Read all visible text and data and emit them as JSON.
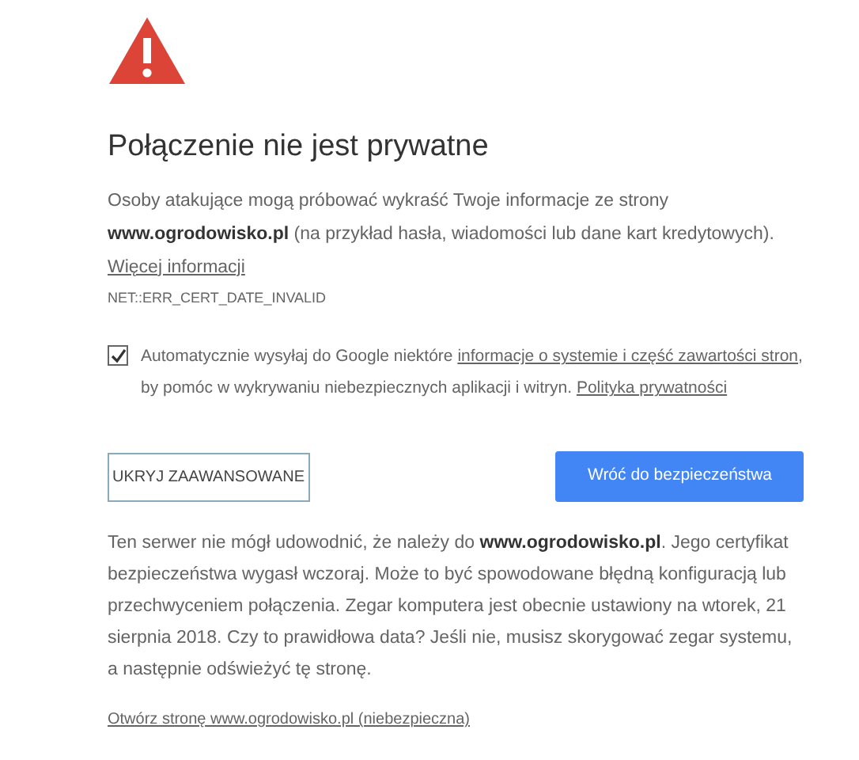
{
  "title": "Połączenie nie jest prywatne",
  "intro": {
    "text": "Osoby atakujące mogą próbować wykraść Twoje informacje ze strony **www.ogrodowisko.pl** (na przykład hasła, wiadomości lub dane kart kredytowych).",
    "link": "Więcej informacji"
  },
  "error_code": "NET::ERR_CERT_DATE_INVALID",
  "report": {
    "checked": true,
    "text_before": "Automatycznie wysyłaj do Google niektóre",
    "link": "informacje o systemie i część zawartości stron",
    "text_after": ", by pomóc w wykrywaniu niebezpiecznych aplikacji i witryn.",
    "privacy_link": "Polityka prywatności"
  },
  "buttons": [
    {
      "kind": "secondary",
      "label": "UKRYJ ZAAWANSOWANE"
    },
    {
      "kind": "primary",
      "label": "Wróć do bezpieczeństwa"
    }
  ],
  "details": "Ten serwer nie mógł udowodnić, że należy do **www.ogrodowisko.pl**. Jego certyfikat bezpieczeństwa wygasł wczoraj. Może to być spowodowane błędną konfiguracją lub przechwyceniem połączenia. Zegar komputera jest obecnie ustawiony na wtorek, 21 sierpnia 2018. Czy to prawidłowa data? Jeśli nie, musisz skorygować zegar systemu, a następnie odświeżyć tę stronę.",
  "proceed_link": "Otwórz stronę www.ogrodowisko.pl (niebezpieczna)"
}
